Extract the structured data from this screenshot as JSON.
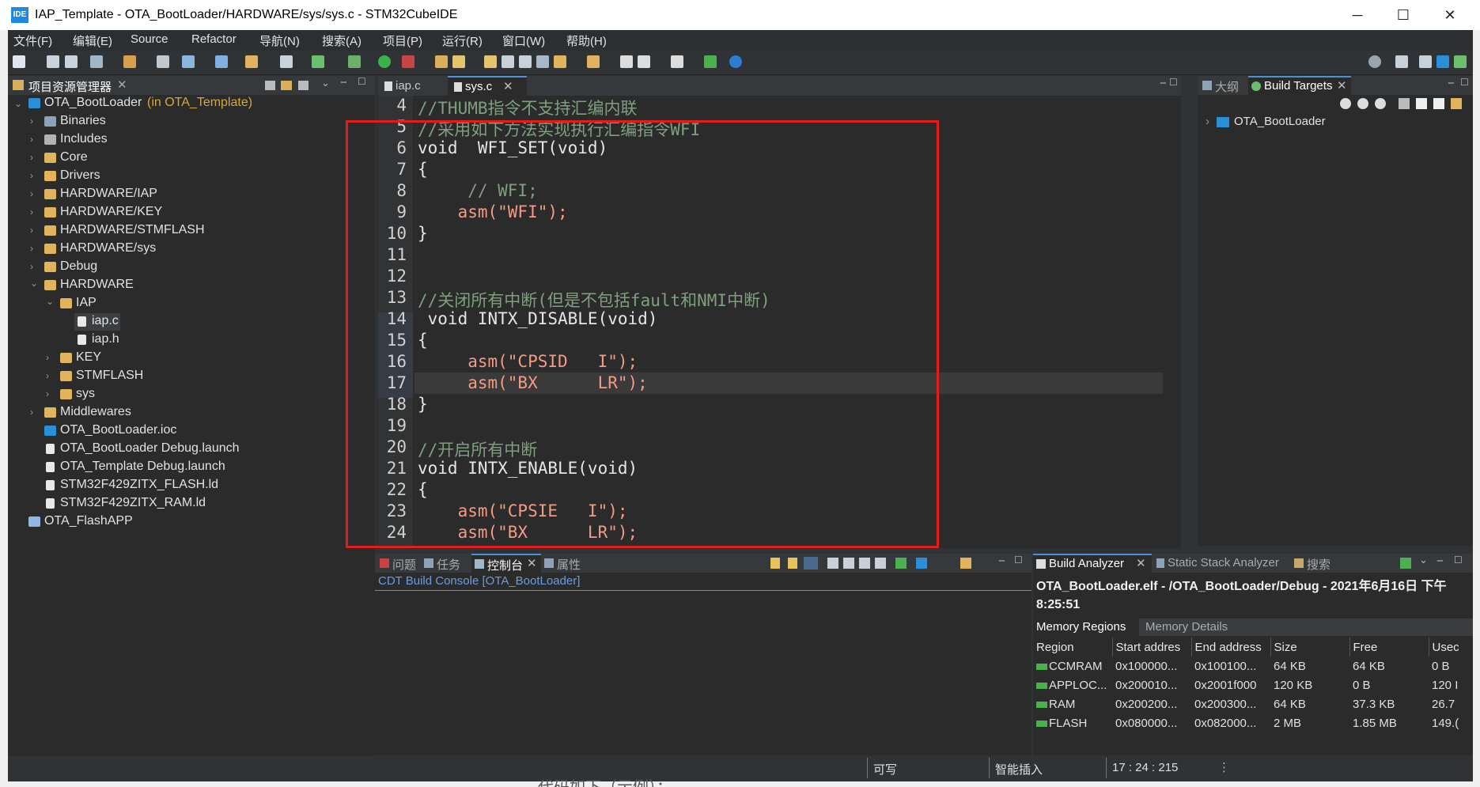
{
  "window": {
    "title": "IAP_Template - OTA_BootLoader/HARDWARE/sys/sys.c - STM32CubeIDE",
    "app_icon": "IDE",
    "minimize": "─",
    "maximize": "☐",
    "close": "✕"
  },
  "menu": [
    "文件(F)",
    "编辑(E)",
    "Source",
    "Refactor",
    "导航(N)",
    "搜索(A)",
    "项目(P)",
    "运行(R)",
    "窗口(W)",
    "帮助(H)"
  ],
  "project_explorer": {
    "tab_label": "项目资源管理器",
    "root": {
      "label": "OTA_BootLoader",
      "suffix": "(in OTA_Template)"
    },
    "items": [
      {
        "label": "Binaries"
      },
      {
        "label": "Includes"
      },
      {
        "label": "Core"
      },
      {
        "label": "Drivers"
      },
      {
        "label": "HARDWARE/IAP"
      },
      {
        "label": "HARDWARE/KEY"
      },
      {
        "label": "HARDWARE/STMFLASH"
      },
      {
        "label": "HARDWARE/sys"
      },
      {
        "label": "Debug"
      },
      {
        "label": "HARDWARE"
      },
      {
        "label": "IAP"
      },
      {
        "label": "iap.c"
      },
      {
        "label": "iap.h"
      },
      {
        "label": "KEY"
      },
      {
        "label": "STMFLASH"
      },
      {
        "label": "sys"
      },
      {
        "label": "Middlewares"
      },
      {
        "label": "OTA_BootLoader.ioc"
      },
      {
        "label": "OTA_BootLoader Debug.launch"
      },
      {
        "label": "OTA_Template Debug.launch"
      },
      {
        "label": "STM32F429ZITX_FLASH.ld"
      },
      {
        "label": "STM32F429ZITX_RAM.ld"
      },
      {
        "label": "OTA_FlashAPP"
      }
    ]
  },
  "editor": {
    "tabs": [
      {
        "label": "iap.c"
      },
      {
        "label": "sys.c"
      }
    ],
    "lines": [
      {
        "num": "4",
        "text": "//THUMB指令不支持汇编内联"
      },
      {
        "num": "5",
        "text": "//采用如下方法实现执行汇编指令WFI"
      },
      {
        "num": "6",
        "text": "void  WFI_SET(void)"
      },
      {
        "num": "7",
        "text": "{"
      },
      {
        "num": "8",
        "text": "     // WFI;"
      },
      {
        "num": "9",
        "text": "    asm(\"WFI\");"
      },
      {
        "num": "10",
        "text": "}"
      },
      {
        "num": "11",
        "text": ""
      },
      {
        "num": "12",
        "text": ""
      },
      {
        "num": "13",
        "text": "//关闭所有中断(但是不包括fault和NMI中断)"
      },
      {
        "num": "14",
        "text": " void INTX_DISABLE(void)"
      },
      {
        "num": "15",
        "text": "{"
      },
      {
        "num": "16",
        "text": "     asm(\"CPSID   I\");"
      },
      {
        "num": "17",
        "text": "     asm(\"BX      LR\");"
      },
      {
        "num": "18",
        "text": "}"
      },
      {
        "num": "19",
        "text": ""
      },
      {
        "num": "20",
        "text": "//开启所有中断"
      },
      {
        "num": "21",
        "text": "void INTX_ENABLE(void)"
      },
      {
        "num": "22",
        "text": "{"
      },
      {
        "num": "23",
        "text": "    asm(\"CPSIE   I\");"
      },
      {
        "num": "24",
        "text": "    asm(\"BX      LR\");"
      }
    ]
  },
  "right_panel": {
    "tabs": [
      {
        "label": "大纲"
      },
      {
        "label": "Build Targets"
      }
    ],
    "tree_item": "OTA_BootLoader"
  },
  "console": {
    "tabs": [
      {
        "label": "问题"
      },
      {
        "label": "任务"
      },
      {
        "label": "控制台"
      },
      {
        "label": "属性"
      }
    ],
    "title": "CDT Build Console [OTA_BootLoader]"
  },
  "build_analyzer": {
    "tabs": [
      {
        "label": "Build Analyzer"
      },
      {
        "label": "Static Stack Analyzer"
      },
      {
        "label": "搜索"
      }
    ],
    "heading": "OTA_BootLoader.elf - /OTA_BootLoader/Debug - 2021年6月16日 下午8:25:51",
    "subtabs": [
      {
        "label": "Memory Regions"
      },
      {
        "label": "Memory Details"
      }
    ],
    "columns": [
      "Region",
      "Start addres",
      "End address",
      "Size",
      "Free",
      "Usec"
    ],
    "rows": [
      {
        "region": "CCMRAM",
        "start": "0x100000...",
        "end": "0x100100...",
        "size": "64 KB",
        "free": "64 KB",
        "used": "0 B"
      },
      {
        "region": "APPLOC...",
        "start": "0x200010...",
        "end": "0x2001f000",
        "size": "120 KB",
        "free": "0 B",
        "used": "120 I"
      },
      {
        "region": "RAM",
        "start": "0x200200...",
        "end": "0x200300...",
        "size": "64 KB",
        "free": "37.3 KB",
        "used": "26.7"
      },
      {
        "region": "FLASH",
        "start": "0x080000...",
        "end": "0x082000...",
        "size": "2 MB",
        "free": "1.85 MB",
        "used": "149.("
      }
    ]
  },
  "status": {
    "writable": "可写",
    "insert_mode": "智能插入",
    "position": "17 : 24 : 215"
  },
  "bottom_overflow": "代码如下（示例）："
}
